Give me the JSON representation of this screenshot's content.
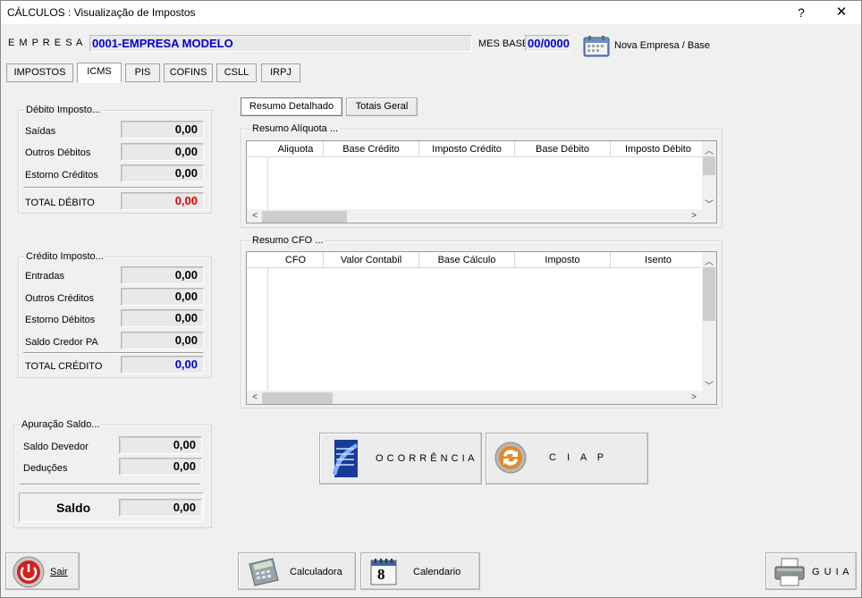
{
  "window": {
    "title": "CÁLCULOS : Visualização de Impostos",
    "help": "?",
    "close": "✕"
  },
  "header": {
    "empresa_label": "E M P R E S A",
    "empresa_value": "0001-EMPRESA MODELO",
    "mes_base_label": "MES BASE",
    "mes_base_value": "00/0000",
    "nova_empresa_label": "Nova Empresa / Base"
  },
  "tabs": [
    "IMPOSTOS",
    "ICMS",
    "PIS",
    "COFINS",
    "CSLL",
    "IRPJ"
  ],
  "debito": {
    "title": "Débito Imposto...",
    "rows": [
      {
        "label": "Saídas",
        "value": "0,00"
      },
      {
        "label": "Outros Débitos",
        "value": "0,00"
      },
      {
        "label": "Estorno Créditos",
        "value": "0,00"
      }
    ],
    "total_label": "TOTAL DÉBITO",
    "total_value": "0,00"
  },
  "credito": {
    "title": "Crédito Imposto...",
    "rows": [
      {
        "label": "Entradas",
        "value": "0,00"
      },
      {
        "label": "Outros Créditos",
        "value": "0,00"
      },
      {
        "label": "Estorno Débitos",
        "value": "0,00"
      },
      {
        "label": "Saldo Credor PA",
        "value": "0,00"
      }
    ],
    "total_label": "TOTAL CRÉDITO",
    "total_value": "0,00"
  },
  "apuracao": {
    "title": "Apuração Saldo...",
    "rows": [
      {
        "label": "Saldo Devedor",
        "value": "0,00"
      },
      {
        "label": "Deduções",
        "value": "0,00"
      }
    ],
    "saldo_label": "Saldo",
    "saldo_value": "0,00"
  },
  "subtabs": [
    "Resumo Detalhado",
    "Totais Geral"
  ],
  "resumo_aliquota": {
    "title": "Resumo Alíquota ...",
    "columns": [
      "Aliquota",
      "Base Crédito",
      "Imposto Crédito",
      "Base Débito",
      "Imposto Débito"
    ]
  },
  "resumo_cfo": {
    "title": "Resumo CFO ...",
    "columns": [
      "CFO",
      "Valor Contabil",
      "Base Cálculo",
      "Imposto",
      "Isento"
    ]
  },
  "actions": {
    "ocorrencia": "O C O R R Ê N C I A",
    "ciap": "C    I    A    P"
  },
  "footer": {
    "sair": "Sair",
    "calculadora": "Calculadora",
    "calendario": "Calendario",
    "calendar_day": "8",
    "guia": "G U I A"
  },
  "colors": {
    "blue": "#0000cc",
    "red": "#e00000"
  }
}
